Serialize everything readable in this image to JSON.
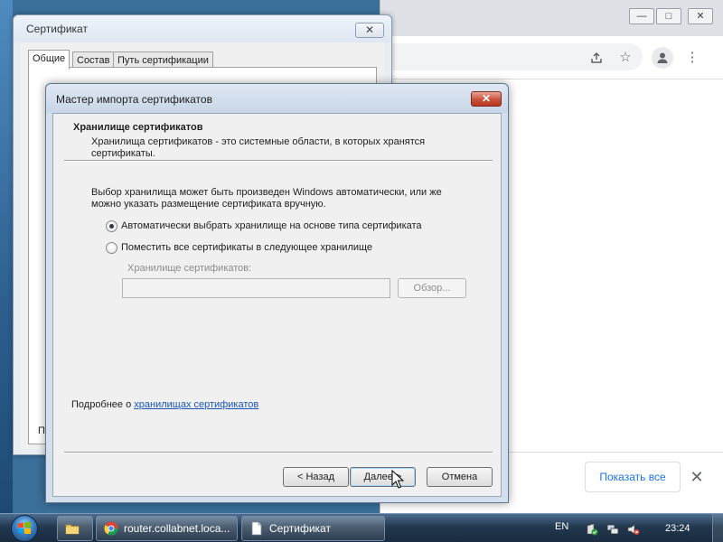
{
  "browser": {
    "window_buttons": {
      "minimize": "—",
      "restore": "□",
      "close": "✕"
    },
    "toolbar_icons": [
      "share-icon",
      "star-icon",
      "account-icon",
      "menu-icon"
    ],
    "download_bar": {
      "show_all_label": "Показать все",
      "close_label": "✕"
    }
  },
  "cert_window": {
    "title": "Сертификат",
    "close_label": "✕",
    "tabs": [
      {
        "label": "Общие",
        "active": true
      },
      {
        "label": "Состав",
        "active": false
      },
      {
        "label": "Путь сертификации",
        "active": false
      }
    ],
    "partial_label": "П"
  },
  "wizard": {
    "title": "Мастер импорта сертификатов",
    "close_label": "✕",
    "header": {
      "title": "Хранилище сертификатов",
      "description": "Хранилища сертификатов - это системные области, в которых хранятся сертификаты."
    },
    "body_text": "Выбор хранилища может быть произведен Windows автоматически, или же можно указать размещение сертификата вручную.",
    "options": [
      {
        "label": "Автоматически выбрать хранилище на основе типа сертификата",
        "checked": true
      },
      {
        "label": "Поместить все сертификаты в следующее хранилище",
        "checked": false
      }
    ],
    "store_label": "Хранилище сертификатов:",
    "store_value": "",
    "browse_label": "Обзор...",
    "more_info_prefix": "Подробнее о ",
    "more_info_link": "хранилищах сертификатов",
    "buttons": {
      "back": "< Назад",
      "next": "Далее >",
      "cancel": "Отмена"
    }
  },
  "taskbar": {
    "items": [
      {
        "label": "",
        "icon": "explorer-folder-icon"
      },
      {
        "label": "router.collabnet.loca...",
        "icon": "chrome-icon"
      },
      {
        "label": "Сертификат",
        "icon": "certificate-icon"
      }
    ],
    "language": "EN",
    "tray_icons": [
      "action-center-icon",
      "network-icon",
      "volume-muted-icon"
    ],
    "clock": "23:24"
  },
  "colors": {
    "wizard_frame": "#d3dfec",
    "link": "#1a55b8",
    "chrome_accent": "#1a73e8",
    "taskbar": "#22384f"
  }
}
